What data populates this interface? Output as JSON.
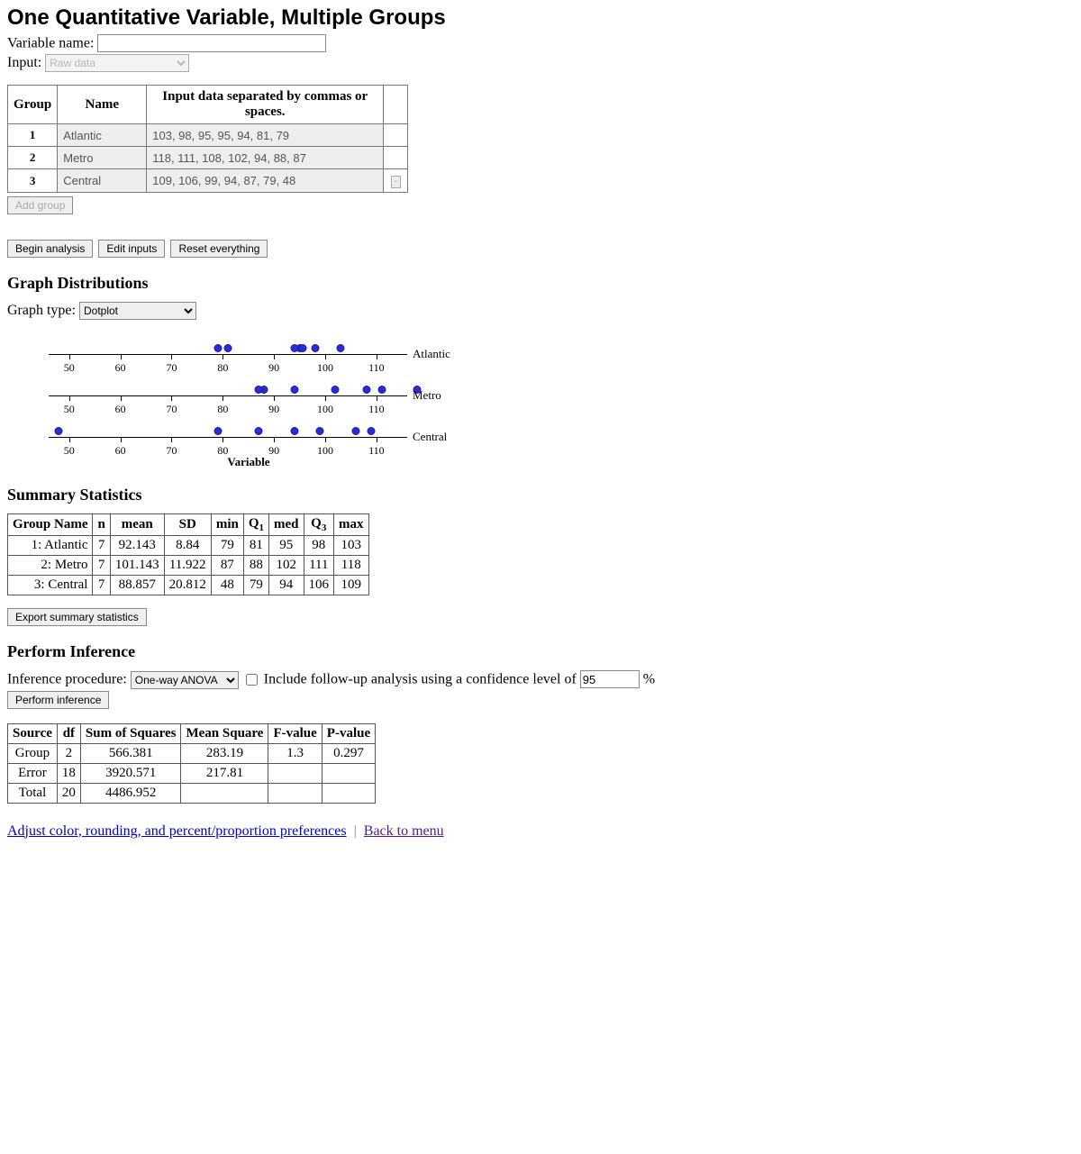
{
  "title": "One Quantitative Variable, Multiple Groups",
  "labels": {
    "variable_name": "Variable name:",
    "input": "Input:",
    "input_select": "Raw data",
    "add_group": "Add group",
    "begin": "Begin analysis",
    "edit": "Edit inputs",
    "reset": "Reset everything",
    "graph_dist": "Graph Distributions",
    "graph_type": "Graph type:",
    "graph_type_sel": "Dotplot",
    "summary": "Summary Statistics",
    "export": "Export summary statistics",
    "inference": "Perform Inference",
    "inf_proc": "Inference procedure:",
    "inf_sel": "One-way ANOVA",
    "followup": "Include follow-up analysis using a confidence level of",
    "pct": "%",
    "perform_inf": "Perform inference",
    "pref_link": "Adjust color, rounding, and percent/proportion preferences",
    "back_link": "Back to menu"
  },
  "input_table": {
    "headers": [
      "Group",
      "Name",
      "Input data separated by commas or spaces."
    ],
    "rows": [
      {
        "num": "1",
        "name": "Atlantic",
        "data": "103, 98, 95, 95, 94, 81, 79"
      },
      {
        "num": "2",
        "name": "Metro",
        "data": "118, 111, 108, 102, 94, 88, 87"
      },
      {
        "num": "3",
        "name": "Central",
        "data": "109, 106, 99, 94, 87, 79, 48"
      }
    ]
  },
  "conf_level": "95",
  "summary_table": {
    "headers": [
      "Group Name",
      "n",
      "mean",
      "SD",
      "min",
      "Q1",
      "med",
      "Q3",
      "max"
    ],
    "rows": [
      [
        "1: Atlantic",
        "7",
        "92.143",
        "8.84",
        "79",
        "81",
        "95",
        "98",
        "103"
      ],
      [
        "2: Metro",
        "7",
        "101.143",
        "11.922",
        "87",
        "88",
        "102",
        "111",
        "118"
      ],
      [
        "3: Central",
        "7",
        "88.857",
        "20.812",
        "48",
        "79",
        "94",
        "106",
        "109"
      ]
    ]
  },
  "anova_table": {
    "headers": [
      "Source",
      "df",
      "Sum of Squares",
      "Mean Square",
      "F-value",
      "P-value"
    ],
    "rows": [
      [
        "Group",
        "2",
        "566.381",
        "283.19",
        "1.3",
        "0.297"
      ],
      [
        "Error",
        "18",
        "3920.571",
        "217.81",
        "",
        ""
      ],
      [
        "Total",
        "20",
        "4486.952",
        "",
        "",
        ""
      ]
    ]
  },
  "chart_data": {
    "type": "scatter",
    "title": "Dotplot",
    "xlabel": "Variable",
    "xlim": [
      46,
      116
    ],
    "xticks": [
      50,
      60,
      70,
      80,
      90,
      100,
      110
    ],
    "series": [
      {
        "name": "Atlantic",
        "values": [
          103,
          98,
          95,
          95,
          94,
          81,
          79
        ]
      },
      {
        "name": "Metro",
        "values": [
          118,
          111,
          108,
          102,
          94,
          88,
          87
        ]
      },
      {
        "name": "Central",
        "values": [
          109,
          106,
          99,
          94,
          87,
          79,
          48
        ]
      }
    ]
  }
}
